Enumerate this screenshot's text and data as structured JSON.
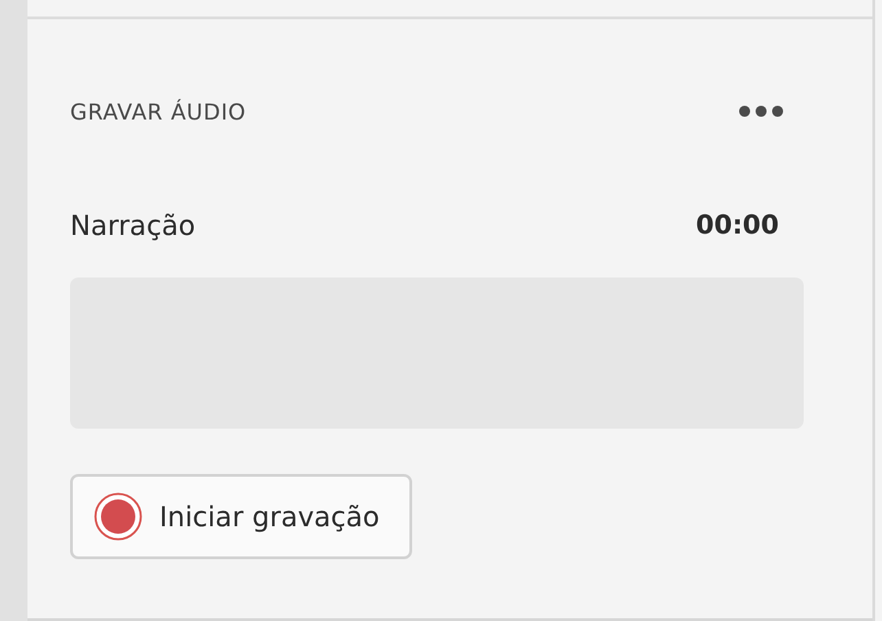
{
  "panel": {
    "title": "GRAVAR ÁUDIO"
  },
  "track": {
    "name": "Narração",
    "time": "00:00"
  },
  "record_button": {
    "label": "Iniciar gravação"
  }
}
